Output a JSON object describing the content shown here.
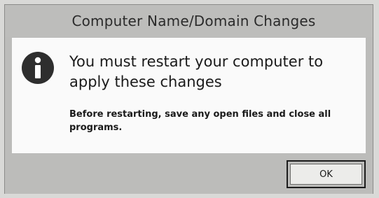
{
  "dialog": {
    "title": "Computer Name/Domain Changes",
    "icon": "info-icon",
    "main_message": "You must restart your computer to apply these changes",
    "sub_message": "Before restarting, save any open files and close all programs.",
    "ok_label": "OK"
  },
  "colors": {
    "chrome": "#bcbcba",
    "content_background": "#fafafa",
    "icon_fill": "#2e2e2e",
    "text": "#1a1a1a"
  }
}
